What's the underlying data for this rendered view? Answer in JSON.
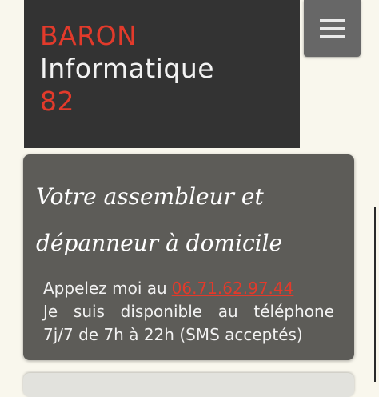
{
  "header": {
    "logo_lines": [
      "BARON",
      "Informatique",
      "82"
    ]
  },
  "menu": {
    "icon": "hamburger-menu-icon"
  },
  "hero": {
    "title_lines": [
      "Votre assembleur et",
      "dépanneur à domicile"
    ],
    "call_prefix": "Appelez moi au",
    "phone": "06.71.62.97.44",
    "availability_line": "Je suis disponible au téléphone",
    "hours_line": "7j/7 de 7h à 22h (SMS acceptés)"
  },
  "colors": {
    "accent": "#e23a2b",
    "header_bg": "#333333",
    "card_bg": "#5d5c58",
    "page_bg": "#f9f7ed",
    "menu_bg": "#676767"
  }
}
